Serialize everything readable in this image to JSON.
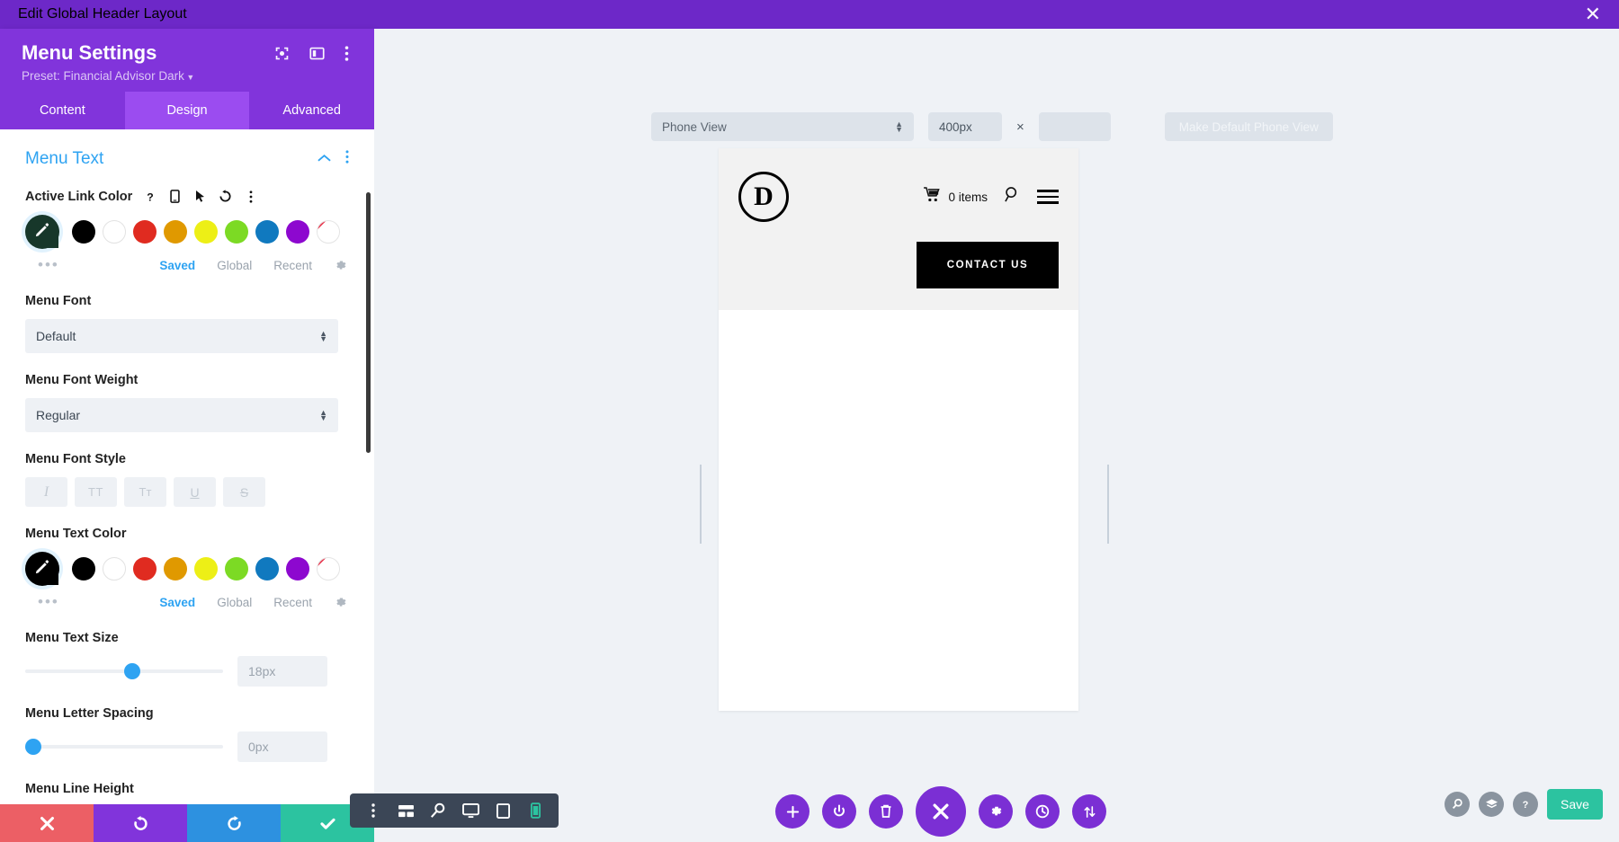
{
  "topbar": {
    "title": "Edit Global Header Layout",
    "close_icon": "close-icon"
  },
  "panel": {
    "title": "Menu Settings",
    "preset_label": "Preset: Financial Advisor Dark",
    "head_icons": [
      "focus-icon",
      "layout-columns-icon",
      "more-vertical-icon"
    ],
    "tabs": [
      {
        "label": "Content",
        "active": false
      },
      {
        "label": "Design",
        "active": true
      },
      {
        "label": "Advanced",
        "active": false
      }
    ],
    "section": {
      "title": "Menu Text",
      "collapse_icon": "chevron-up-icon",
      "more_icon": "more-vertical-icon"
    },
    "fields": {
      "active_link_color": {
        "label": "Active Link Color",
        "mini_icons": [
          "help-icon",
          "responsive-icon",
          "hover-icon",
          "reset-icon",
          "more-vertical-icon"
        ],
        "picker_color": "#17372a",
        "swatches": [
          "#000000",
          "#ffffff",
          "#e02b20",
          "#e09900",
          "#edef16",
          "#7cda24",
          "#1079bf",
          "#8d08cf",
          "none"
        ],
        "links": [
          {
            "label": "Saved",
            "active": true
          },
          {
            "label": "Global",
            "active": false
          },
          {
            "label": "Recent",
            "active": false
          }
        ],
        "gear_icon": "gear-icon",
        "dots_icon": "more-horizontal-icon"
      },
      "menu_font": {
        "label": "Menu Font",
        "value": "Default"
      },
      "menu_font_weight": {
        "label": "Menu Font Weight",
        "value": "Regular"
      },
      "menu_font_style": {
        "label": "Menu Font Style",
        "buttons": [
          {
            "glyph": "I",
            "name": "italic-button"
          },
          {
            "glyph": "TT",
            "name": "uppercase-button"
          },
          {
            "glyph": "Tᴛ",
            "name": "smallcaps-button"
          },
          {
            "glyph": "U",
            "name": "underline-button"
          },
          {
            "glyph": "S",
            "name": "strikethrough-button"
          }
        ]
      },
      "menu_text_color": {
        "label": "Menu Text Color",
        "picker_color": "#000000",
        "swatches": [
          "#000000",
          "#ffffff",
          "#e02b20",
          "#e09900",
          "#edef16",
          "#7cda24",
          "#1079bf",
          "#8d08cf",
          "none"
        ],
        "links": [
          {
            "label": "Saved",
            "active": true
          },
          {
            "label": "Global",
            "active": false
          },
          {
            "label": "Recent",
            "active": false
          }
        ],
        "gear_icon": "gear-icon",
        "dots_icon": "more-horizontal-icon"
      },
      "menu_text_size": {
        "label": "Menu Text Size",
        "value": "18px",
        "slider_percent": 50
      },
      "menu_letter_spacing": {
        "label": "Menu Letter Spacing",
        "value": "0px",
        "slider_percent": 3
      },
      "menu_line_height": {
        "label": "Menu Line Height"
      }
    },
    "actions": [
      {
        "name": "cancel-button",
        "icon": "close-icon",
        "color": "#ec5f65"
      },
      {
        "name": "undo-button",
        "icon": "undo-icon",
        "color": "#8134db"
      },
      {
        "name": "redo-button",
        "icon": "redo-icon",
        "color": "#2d91e0"
      },
      {
        "name": "save-button",
        "icon": "check-icon",
        "color": "#2cc3a0"
      }
    ]
  },
  "canvas": {
    "view_toolbar": {
      "view_select": "Phone View",
      "width_value": "400px",
      "times_symbol": "×",
      "height_value": "",
      "make_default_label": "Make Default Phone View"
    },
    "preview": {
      "logo_letter": "D",
      "cart_icon": "cart-icon",
      "cart_label": "0 items",
      "search_icon": "search-icon",
      "menu_icon": "hamburger-icon",
      "contact_button": "CONTACT US"
    }
  },
  "bottom": {
    "view_tools": [
      {
        "name": "more-vertical-icon",
        "active": false
      },
      {
        "name": "wireframe-icon",
        "active": false
      },
      {
        "name": "zoom-icon",
        "active": false
      },
      {
        "name": "desktop-icon",
        "active": false
      },
      {
        "name": "tablet-icon",
        "active": false
      },
      {
        "name": "phone-icon",
        "active": true
      }
    ],
    "circle_buttons": [
      {
        "name": "add-icon",
        "big": false
      },
      {
        "name": "power-icon",
        "big": false
      },
      {
        "name": "trash-icon",
        "big": false
      },
      {
        "name": "close-icon",
        "big": true
      },
      {
        "name": "gear-icon",
        "big": false
      },
      {
        "name": "history-icon",
        "big": false
      },
      {
        "name": "sort-icon",
        "big": false
      }
    ],
    "right_tools": [
      {
        "name": "search-icon"
      },
      {
        "name": "layers-icon"
      },
      {
        "name": "help-icon"
      }
    ],
    "save_label": "Save"
  }
}
